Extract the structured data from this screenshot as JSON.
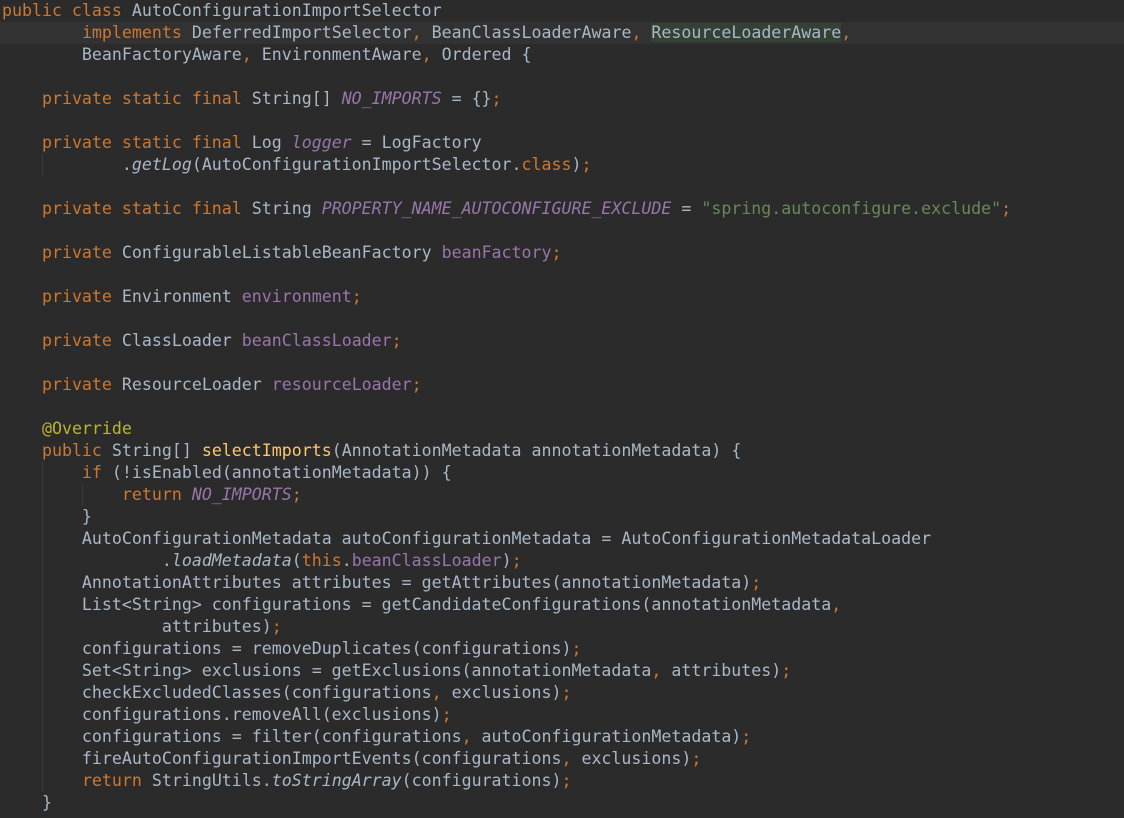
{
  "editor": {
    "lines": [
      [
        [
          "public class ",
          "kw"
        ],
        [
          "AutoConfigurationImportSelector",
          "def"
        ]
      ],
      [
        [
          "        ",
          ""
        ],
        [
          "implements ",
          "kw"
        ],
        [
          "DeferredImportSelector",
          "def"
        ],
        [
          ", ",
          "kw"
        ],
        [
          "BeanClassLoaderAware",
          "def"
        ],
        [
          ", ",
          "kw"
        ],
        [
          "Re",
          "def hl"
        ],
        [
          "|",
          "caret"
        ],
        [
          "sourceLoaderAware",
          "def hl"
        ],
        [
          ",",
          "kw"
        ]
      ],
      [
        [
          "        BeanFactoryAware",
          "def"
        ],
        [
          ", ",
          "kw"
        ],
        [
          "EnvironmentAware",
          "def"
        ],
        [
          ", ",
          "kw"
        ],
        [
          "Ordered {",
          "def"
        ]
      ],
      [],
      [
        [
          "    ",
          ""
        ],
        [
          "private static final ",
          "kw"
        ],
        [
          "String[] ",
          "def"
        ],
        [
          "NO_IMPORTS",
          "const"
        ],
        [
          " = {}",
          "def"
        ],
        [
          ";",
          "kw"
        ]
      ],
      [],
      [
        [
          "    ",
          ""
        ],
        [
          "private static final ",
          "kw"
        ],
        [
          "Log ",
          "def"
        ],
        [
          "logger",
          "const"
        ],
        [
          " = LogFactory",
          "def"
        ]
      ],
      [
        [
          "            .",
          ""
        ],
        [
          "getLog",
          "static"
        ],
        [
          "(AutoConfigurationImportSelector.",
          "def"
        ],
        [
          "class",
          "kw"
        ],
        [
          ")",
          "def"
        ],
        [
          ";",
          "kw"
        ]
      ],
      [],
      [
        [
          "    ",
          ""
        ],
        [
          "private static final ",
          "kw"
        ],
        [
          "String ",
          "def"
        ],
        [
          "PROPERTY_NAME_AUTOCONFIGURE_EXCLUDE",
          "const"
        ],
        [
          " = ",
          "def"
        ],
        [
          "\"spring.autoconfigure.exclude\"",
          "str"
        ],
        [
          ";",
          "kw"
        ]
      ],
      [],
      [
        [
          "    ",
          ""
        ],
        [
          "private ",
          "kw"
        ],
        [
          "ConfigurableListableBeanFactory ",
          "def"
        ],
        [
          "beanFactory",
          "field"
        ],
        [
          ";",
          "kw"
        ]
      ],
      [],
      [
        [
          "    ",
          ""
        ],
        [
          "private ",
          "kw"
        ],
        [
          "Environment ",
          "def"
        ],
        [
          "environment",
          "field"
        ],
        [
          ";",
          "kw"
        ]
      ],
      [],
      [
        [
          "    ",
          ""
        ],
        [
          "private ",
          "kw"
        ],
        [
          "ClassLoader ",
          "def"
        ],
        [
          "beanClassLoader",
          "field"
        ],
        [
          ";",
          "kw"
        ]
      ],
      [],
      [
        [
          "    ",
          ""
        ],
        [
          "private ",
          "kw"
        ],
        [
          "ResourceLoader ",
          "def"
        ],
        [
          "resourceLoader",
          "field"
        ],
        [
          ";",
          "kw"
        ]
      ],
      [],
      [
        [
          "    ",
          ""
        ],
        [
          "@Override",
          "ann"
        ]
      ],
      [
        [
          "    ",
          ""
        ],
        [
          "public ",
          "kw"
        ],
        [
          "String[] ",
          "def"
        ],
        [
          "selectImports",
          "fn"
        ],
        [
          "(AnnotationMetadata annotationMetadata) {",
          "def"
        ]
      ],
      [
        [
          "        ",
          ""
        ],
        [
          "if ",
          "kw"
        ],
        [
          "(!isEnabled(annotationMetadata)) {",
          "def"
        ]
      ],
      [
        [
          "            ",
          ""
        ],
        [
          "return ",
          "kw"
        ],
        [
          "NO_IMPORTS",
          "const"
        ],
        [
          ";",
          "kw"
        ]
      ],
      [
        [
          "        }",
          "def"
        ]
      ],
      [
        [
          "        AutoConfigurationMetadata autoConfigurationMetadata = AutoConfigurationMetadataLoader",
          "def"
        ]
      ],
      [
        [
          "                .",
          ""
        ],
        [
          "loadMetadata",
          "static"
        ],
        [
          "(",
          "def"
        ],
        [
          "this",
          "kw"
        ],
        [
          ".",
          "def"
        ],
        [
          "beanClassLoader",
          "field"
        ],
        [
          ")",
          "def"
        ],
        [
          ";",
          "kw"
        ]
      ],
      [
        [
          "        AnnotationAttributes attributes = getAttributes(annotationMetadata)",
          "def"
        ],
        [
          ";",
          "kw"
        ]
      ],
      [
        [
          "        List<String> configurations = getCandidateConfigurations(annotationMetadata",
          "def"
        ],
        [
          ",",
          "kw"
        ]
      ],
      [
        [
          "                attributes)",
          "def"
        ],
        [
          ";",
          "kw"
        ]
      ],
      [
        [
          "        configurations = removeDuplicates(configurations)",
          "def"
        ],
        [
          ";",
          "kw"
        ]
      ],
      [
        [
          "        Set<String> exclusions = getExclusions(annotationMetadata",
          "def"
        ],
        [
          ", ",
          "kw"
        ],
        [
          "attributes)",
          "def"
        ],
        [
          ";",
          "kw"
        ]
      ],
      [
        [
          "        checkExcludedClasses(configurations",
          "def"
        ],
        [
          ", ",
          "kw"
        ],
        [
          "exclusions)",
          "def"
        ],
        [
          ";",
          "kw"
        ]
      ],
      [
        [
          "        configurations.removeAll(exclusions)",
          "def"
        ],
        [
          ";",
          "kw"
        ]
      ],
      [
        [
          "        configurations = filter(configurations",
          "def"
        ],
        [
          ", ",
          "kw"
        ],
        [
          "autoConfigurationMetadata)",
          "def"
        ],
        [
          ";",
          "kw"
        ]
      ],
      [
        [
          "        fireAutoConfigurationImportEvents(configurations",
          "def"
        ],
        [
          ", ",
          "kw"
        ],
        [
          "exclusions)",
          "def"
        ],
        [
          ";",
          "kw"
        ]
      ],
      [
        [
          "        ",
          ""
        ],
        [
          "return ",
          "kw"
        ],
        [
          "StringUtils.",
          "def"
        ],
        [
          "toStringArray",
          "static"
        ],
        [
          "(configurations)",
          "def"
        ],
        [
          ";",
          "kw"
        ]
      ],
      [
        [
          "    }",
          "def"
        ]
      ]
    ]
  }
}
